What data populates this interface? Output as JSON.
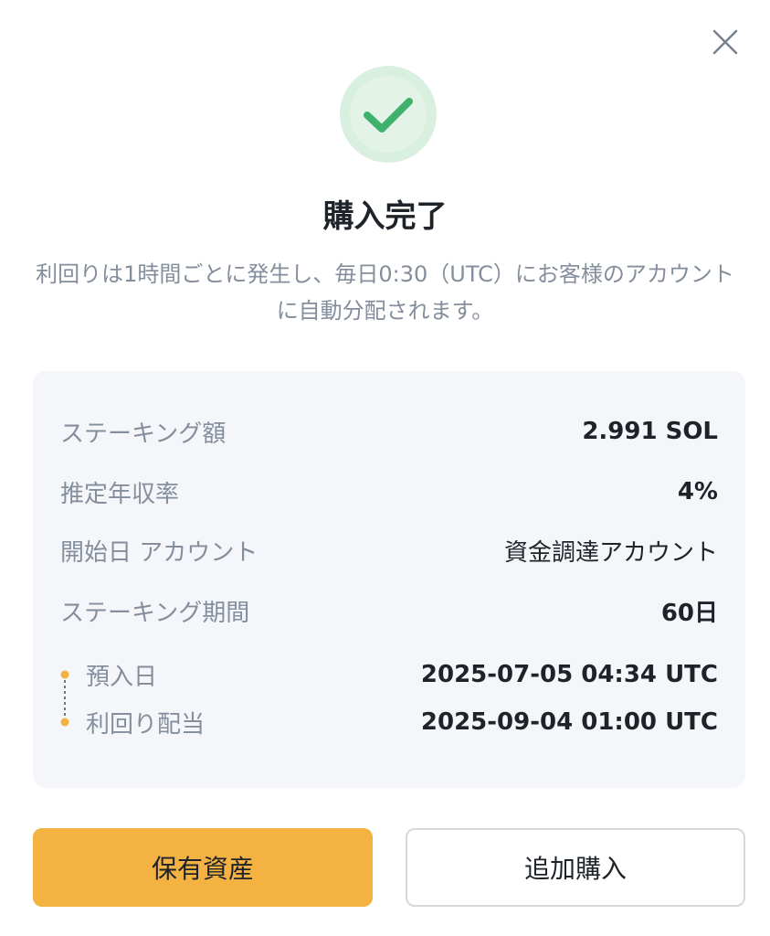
{
  "dialog": {
    "close_icon": "close-icon",
    "success_icon": "checkmark-circle-icon",
    "title": "購入完了",
    "description": "利回りは1時間ごとに発生し、毎日0:30（UTC）にお客様のアカウントに自動分配されます。"
  },
  "details": {
    "staking_amount": {
      "label": "ステーキング額",
      "value": "2.991 SOL"
    },
    "estimated_apr": {
      "label": "推定年収率",
      "value": "4%"
    },
    "start_account": {
      "label": "開始日 アカウント",
      "value": "資金調達アカウント"
    },
    "staking_period": {
      "label": "ステーキング期間",
      "value": "60日"
    },
    "deposit_date": {
      "label": "預入日",
      "value": "2025-07-05 04:34 UTC"
    },
    "yield_payout": {
      "label": "利回り配当",
      "value": "2025-09-04 01:00 UTC"
    }
  },
  "actions": {
    "holdings_label": "保有資産",
    "buy_more_label": "追加購入"
  },
  "colors": {
    "accent": "#f3b242",
    "success": "#3fb16d",
    "success_bg": "#d9f0e0",
    "card_bg": "#f5f6fa",
    "muted_text": "#848e9c"
  }
}
